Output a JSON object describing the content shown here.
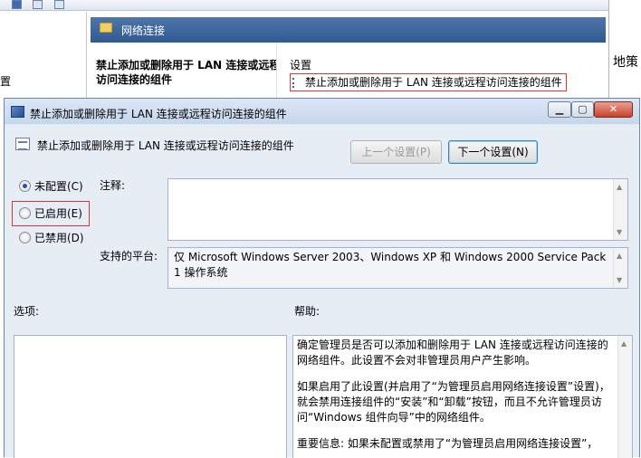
{
  "background": {
    "pane_title": "网络连接",
    "tree_text": "置",
    "desc_title": "禁止添加或删除用于 LAN 连接或远程访问连接的组件",
    "list_header": "设置",
    "list_row": "禁止添加或删除用于 LAN 连接或远程访问连接的组件",
    "right_text": "地策"
  },
  "dialog": {
    "title": "禁止添加或删除用于 LAN 连接或远程访问连接的组件",
    "minimize": "▁",
    "maximize": "▢",
    "close": "✕",
    "policy_title": "禁止添加或删除用于 LAN 连接或远程访问连接的组件",
    "prev_button": "上一个设置(P)",
    "next_button": "下一个设置(N)",
    "radios": [
      {
        "label": "未配置(C)",
        "checked": true
      },
      {
        "label": "已启用(E)",
        "checked": false
      },
      {
        "label": "已禁用(D)",
        "checked": false
      }
    ],
    "comment_label": "注释:",
    "comment_value": "",
    "platform_label": "支持的平台:",
    "platform_value": "仅 Microsoft Windows Server 2003、Windows XP 和 Windows 2000 Service Pack 1 操作系统",
    "options_label": "选项:",
    "help_label": "帮助:",
    "help_paragraphs": [
      "确定管理员是否可以添加和删除用于 LAN 连接或远程访问连接的网络组件。此设置不会对非管理员用户产生影响。",
      "如果启用了此设置(并启用了“为管理员启用网络连接设置”设置)，就会禁用连接组件的“安装”和“卸载”按钮，而且不允许管理员访问“Windows 组件向导”中的网络组件。",
      "重要信息: 如果未配置或禁用了“为管理员启用网络连接设置”，"
    ]
  },
  "colors": {
    "highlight_border": "#d23a3a",
    "title_bar": "#c5d6ec",
    "pane_header": "#2f5a92"
  }
}
